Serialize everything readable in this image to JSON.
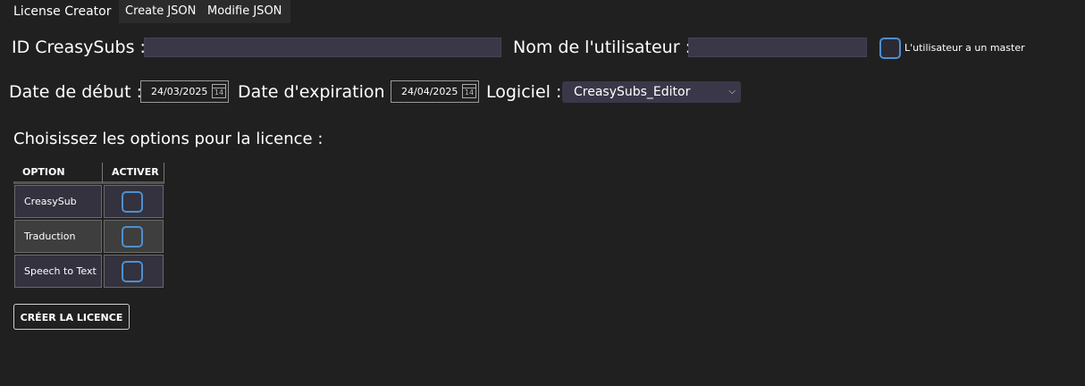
{
  "tabs": [
    {
      "label": "License Creator",
      "active": true
    },
    {
      "label": "Create JSON",
      "active": false
    },
    {
      "label": "Modifie JSON",
      "active": false
    }
  ],
  "form": {
    "id_label": "ID CreasySubs :",
    "id_value": "",
    "user_label": "Nom de l'utilisateur :",
    "user_value": "",
    "master_label": "L'utilisateur a un master",
    "master_checked": false,
    "start_label": "Date de début :",
    "start_value": "24/03/2025",
    "end_label": "Date d'expiration :",
    "end_value": "24/04/2025",
    "software_label": "Logiciel :",
    "software_value": "CreasySubs_Editor",
    "calendar_day": "14"
  },
  "options": {
    "heading": "Choisissez les options pour la licence :",
    "columns": [
      "OPTION",
      "ACTIVER"
    ],
    "rows": [
      {
        "name": "CreasySub",
        "enabled": false
      },
      {
        "name": "Traduction",
        "enabled": false
      },
      {
        "name": "Speech to Text",
        "enabled": false
      }
    ]
  },
  "actions": {
    "create_label": "CRÉER LA LICENCE"
  },
  "colors": {
    "background": "#202020",
    "input_bg": "#3a3848",
    "checkbox_border": "#4f8fcf"
  }
}
